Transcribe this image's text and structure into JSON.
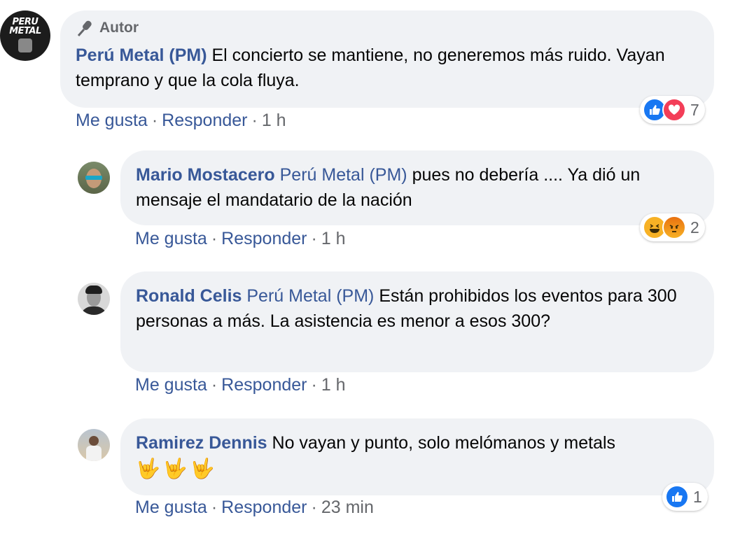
{
  "comments": [
    {
      "badge": "Autor",
      "author": "Perú Metal (PM)",
      "text": "El concierto se mantiene, no generemos más ruido. Vayan temprano y que la cola fluya.",
      "actions": {
        "like": "Me gusta",
        "reply": "Responder",
        "time": "1 h"
      },
      "reactions": {
        "icons": [
          "like-icon",
          "love-icon"
        ],
        "count": "7"
      },
      "avatar_text": [
        "PERU",
        "METAL"
      ]
    },
    {
      "author": "Mario Mostacero",
      "mention": "Perú Metal (PM)",
      "text": "pues no debería .... Ya dió un mensaje el mandatario de la nación",
      "actions": {
        "like": "Me gusta",
        "reply": "Responder",
        "time": "1 h"
      },
      "reactions": {
        "icons": [
          "haha-icon",
          "angry-icon"
        ],
        "count": "2"
      }
    },
    {
      "author": "Ronald Celis",
      "mention": "Perú Metal (PM)",
      "text": "Están prohibidos los eventos para 300 personas a más. La asistencia es menor a esos 300?",
      "actions": {
        "like": "Me gusta",
        "reply": "Responder",
        "time": "1 h"
      }
    },
    {
      "author": "Ramirez Dennis",
      "text": "No vayan y punto, solo melómanos y metals",
      "emojis": "🤟🤟🤟",
      "actions": {
        "like": "Me gusta",
        "reply": "Responder",
        "time": "23 min"
      },
      "reactions": {
        "icons": [
          "like-icon"
        ],
        "count": "1"
      }
    }
  ],
  "colors": {
    "link": "#385898",
    "bubble": "#f0f2f5",
    "meta": "#65676b",
    "like": "#1877f2",
    "love": "#f33e58"
  }
}
